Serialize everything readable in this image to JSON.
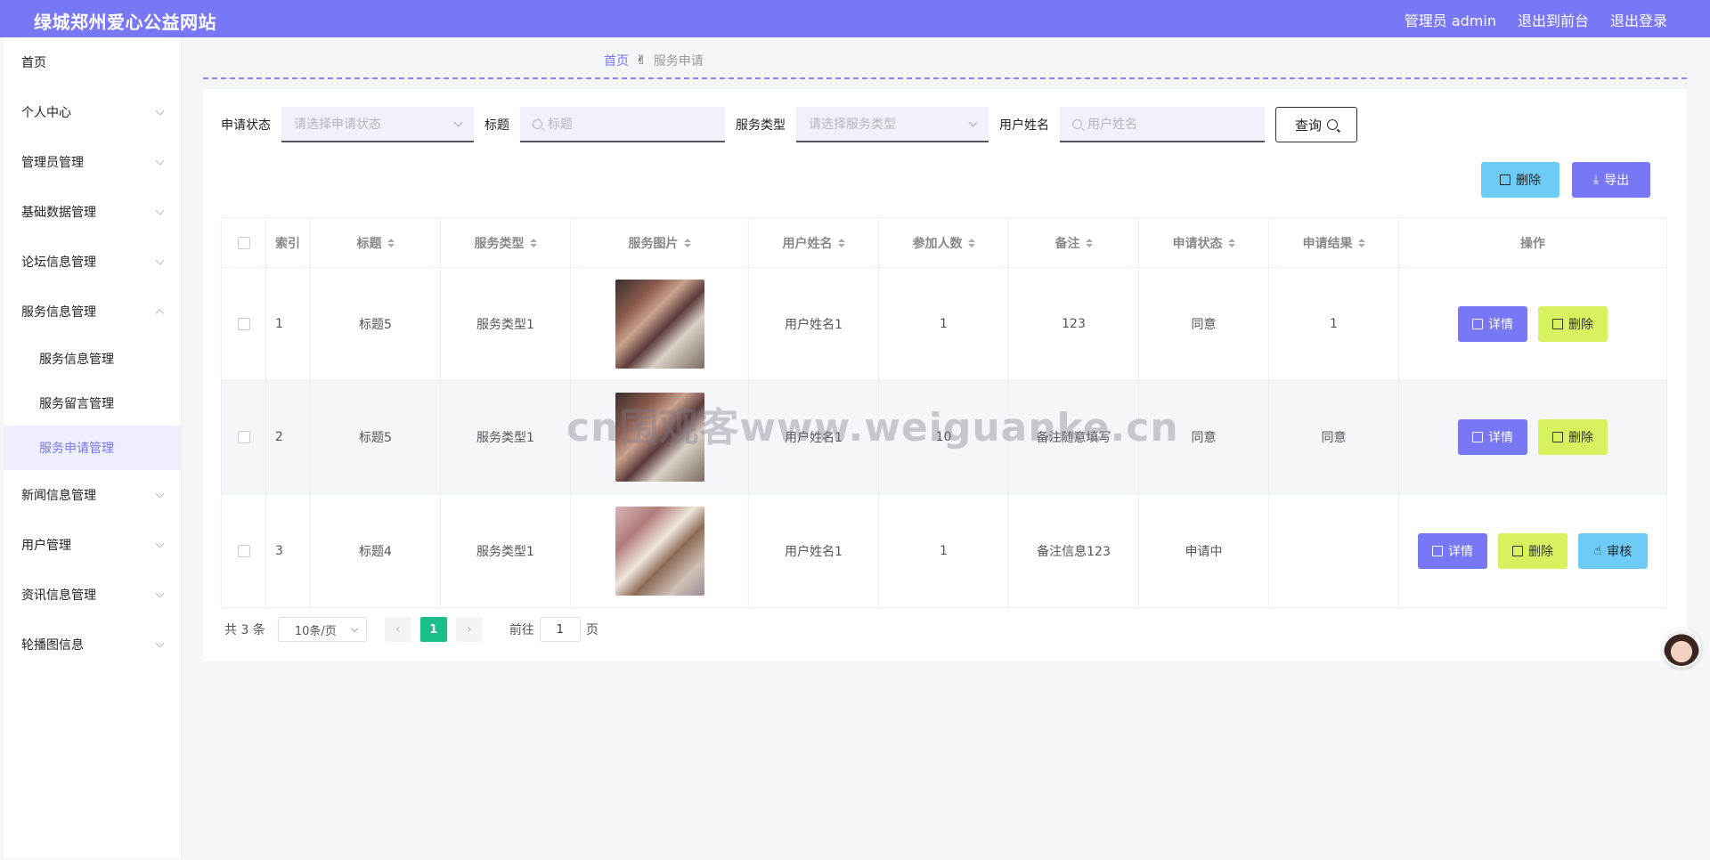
{
  "header": {
    "brand": "绿城郑州爱心公益网站",
    "admin_label": "管理员 admin",
    "to_front": "退出到前台",
    "logout": "退出登录",
    "bar_color": "#7877f6"
  },
  "sidebar": {
    "items": [
      {
        "label": "首页"
      },
      {
        "label": "个人中心"
      },
      {
        "label": "管理员管理"
      },
      {
        "label": "基础数据管理"
      },
      {
        "label": "论坛信息管理"
      },
      {
        "label": "服务信息管理"
      },
      {
        "label": "新闻信息管理"
      },
      {
        "label": "用户管理"
      },
      {
        "label": "资讯信息管理"
      },
      {
        "label": "轮播图信息"
      }
    ],
    "subitems": [
      {
        "label": "服务信息管理"
      },
      {
        "label": "服务留言管理"
      },
      {
        "label": "服务申请管理"
      }
    ]
  },
  "breadcrumb": {
    "home": "首页",
    "separator_icon": "hand-icon",
    "current": "服务申请"
  },
  "filters": {
    "status_label": "申请状态",
    "status_placeholder": "请选择申请状态",
    "title_label": "标题",
    "title_placeholder": "标题",
    "type_label": "服务类型",
    "type_placeholder": "请选择服务类型",
    "user_label": "用户姓名",
    "user_placeholder": "用户姓名",
    "query_button": "查询"
  },
  "actions": {
    "delete": "删除",
    "export": "导出"
  },
  "table": {
    "headers": [
      "索引",
      "标题",
      "服务类型",
      "服务图片",
      "用户姓名",
      "参加人数",
      "备注",
      "申请状态",
      "申请结果",
      "操作"
    ],
    "rows": [
      {
        "index": "1",
        "title": "标题5",
        "type": "服务类型1",
        "user": "用户姓名1",
        "count": "1",
        "remark": "123",
        "status": "同意",
        "result": "1"
      },
      {
        "index": "2",
        "title": "标题5",
        "type": "服务类型1",
        "user": "用户姓名1",
        "count": "10",
        "remark": "备注随意填写",
        "status": "同意",
        "result": "同意"
      },
      {
        "index": "3",
        "title": "标题4",
        "type": "服务类型1",
        "user": "用户姓名1",
        "count": "1",
        "remark": "备注信息123",
        "status": "申请中",
        "result": ""
      }
    ],
    "op_detail": "详情",
    "op_delete": "删除",
    "op_audit": "审核"
  },
  "pagination": {
    "total": "共 3 条",
    "page_size": "10条/页",
    "current_page": "1",
    "goto_label": "前往",
    "goto_value": "1",
    "page_suffix": "页"
  },
  "watermark": "cn围观客www.weiguanke.cn"
}
